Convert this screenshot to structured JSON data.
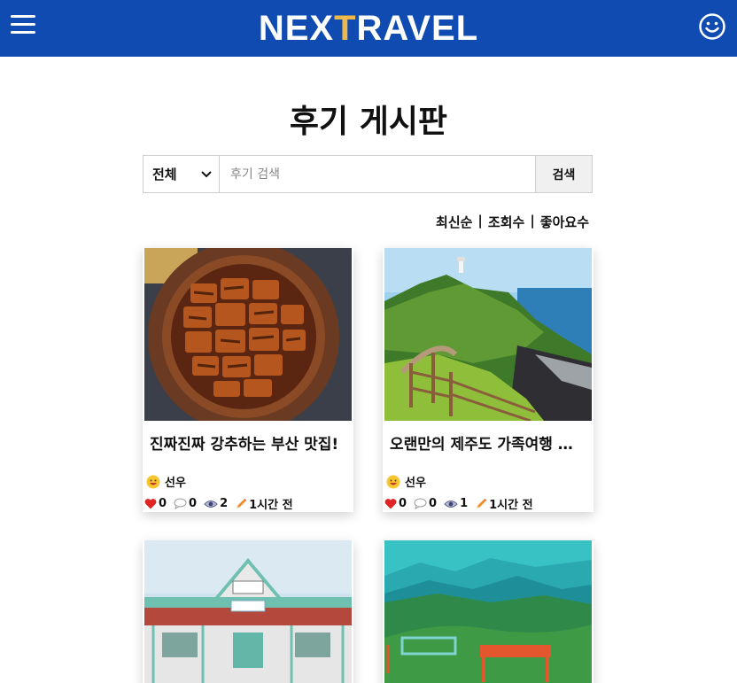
{
  "header": {
    "logo_part1": "NEX",
    "logo_accent": "T",
    "logo_part2": "RAVEL",
    "accent_color": "#f0b84a",
    "bar_color": "#0f4bb0"
  },
  "page": {
    "title": "후기 게시판"
  },
  "search": {
    "category_value": "전체",
    "placeholder": "후기 검색",
    "button_label": "검색"
  },
  "sort": {
    "options": [
      "최신순",
      "조회수",
      "좋아요수"
    ],
    "separator": "|"
  },
  "posts": [
    {
      "title": "진짜진짜 강추하는 부산 맛집!",
      "author": "선우",
      "likes": "0",
      "comments": "0",
      "views": "2",
      "time": "1시간 전",
      "image": "grilled-eel-rice-bowl"
    },
    {
      "title": "오랜만의 제주도 가족여행 후···",
      "author": "선우",
      "likes": "0",
      "comments": "0",
      "views": "1",
      "time": "1시간 전",
      "image": "jeju-coastal-trail"
    },
    {
      "image": "train-station-building"
    },
    {
      "image": "mountain-view-benches"
    }
  ]
}
